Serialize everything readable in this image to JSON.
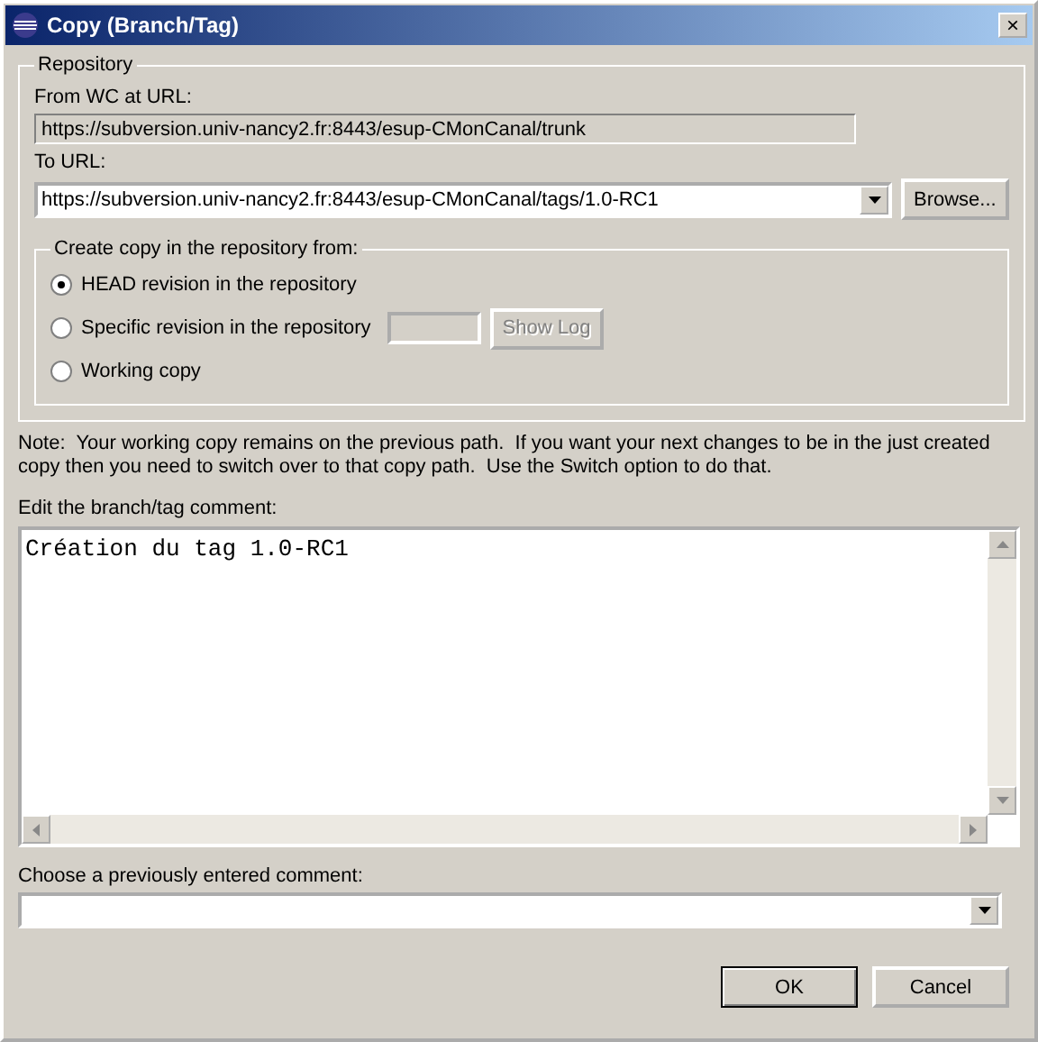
{
  "window": {
    "title": "Copy (Branch/Tag)",
    "close": "×"
  },
  "repository": {
    "title": "Repository",
    "from_label": "From WC at URL:",
    "from_url": "https://subversion.univ-nancy2.fr:8443/esup-CMonCanal/trunk",
    "to_label": "To URL:",
    "to_url": "https://subversion.univ-nancy2.fr:8443/esup-CMonCanal/tags/1.0-RC1",
    "browse": "Browse...",
    "source": {
      "title": "Create copy in the repository from:",
      "options": [
        {
          "kind": "plain",
          "label": "HEAD revision in the repository",
          "selected": true
        },
        {
          "kind": "revision",
          "label": "Specific revision in the repository",
          "selected": false,
          "show_log": "Show Log",
          "disabled": true
        },
        {
          "kind": "plain",
          "label": "Working copy",
          "selected": false
        }
      ]
    }
  },
  "note": "Note:  Your working copy remains on the previous path.  If you want your next changes to be in the just created copy then you need to switch over to that copy path.  Use the Switch option to do that.",
  "comment": {
    "label": "Edit the branch/tag comment:",
    "value": "Création du tag 1.0-RC1"
  },
  "previous": {
    "label": "Choose a previously entered comment:"
  },
  "buttons": [
    "OK",
    "Cancel"
  ]
}
